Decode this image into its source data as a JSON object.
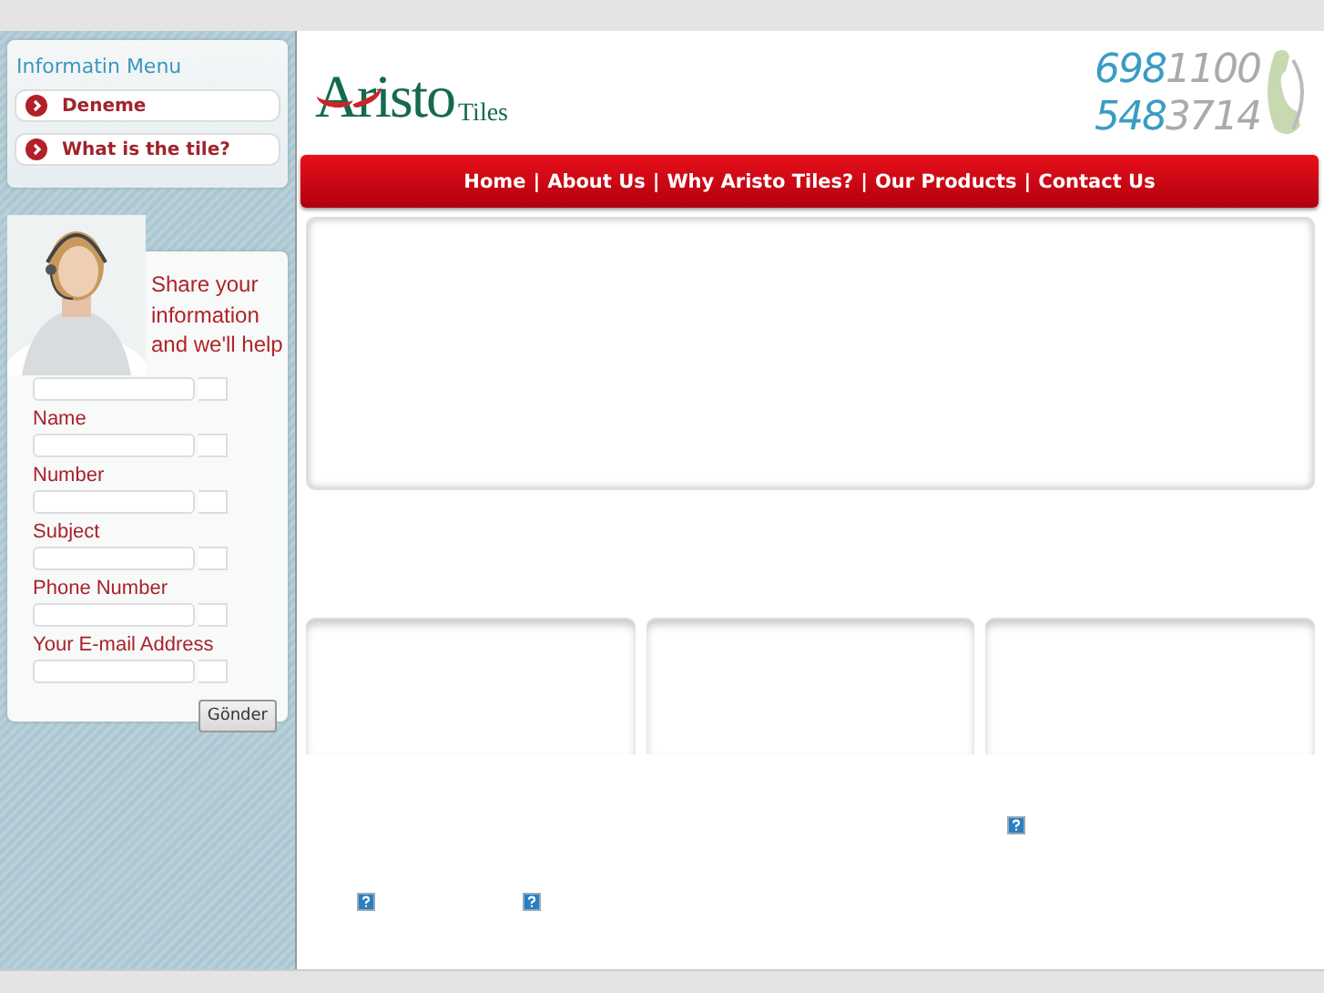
{
  "sidebar": {
    "menu_title": "Informatin Menu",
    "menu_items": [
      {
        "label": "Deneme"
      },
      {
        "label": "What is the tile?"
      }
    ],
    "contact_form": {
      "intro": "Share your information and we'll help",
      "items": [
        {
          "kind": "field"
        },
        {
          "kind": "label",
          "text": "Name"
        },
        {
          "kind": "field"
        },
        {
          "kind": "label",
          "text": "Number"
        },
        {
          "kind": "field"
        },
        {
          "kind": "label",
          "text": "Subject"
        },
        {
          "kind": "field"
        },
        {
          "kind": "label",
          "text": "Phone Number"
        },
        {
          "kind": "field"
        },
        {
          "kind": "label",
          "text": "Your E-mail Address"
        },
        {
          "kind": "field"
        }
      ],
      "submit": "Gönder"
    }
  },
  "header": {
    "logo": {
      "name": "Aristo",
      "suffix": "Tiles"
    },
    "phone_lines": [
      {
        "prefix": "698",
        "number": "1100"
      },
      {
        "prefix": "548",
        "number": "3714"
      }
    ]
  },
  "nav": {
    "separator": "|",
    "links": [
      "Home",
      "About Us",
      "Why Aristo Tiles?",
      "Our Products",
      "Contact Us"
    ]
  },
  "content": {
    "broken_images": [
      {
        "kind": "broken_image"
      },
      {
        "kind": "broken_image"
      },
      {
        "kind": "broken_image"
      }
    ]
  }
}
